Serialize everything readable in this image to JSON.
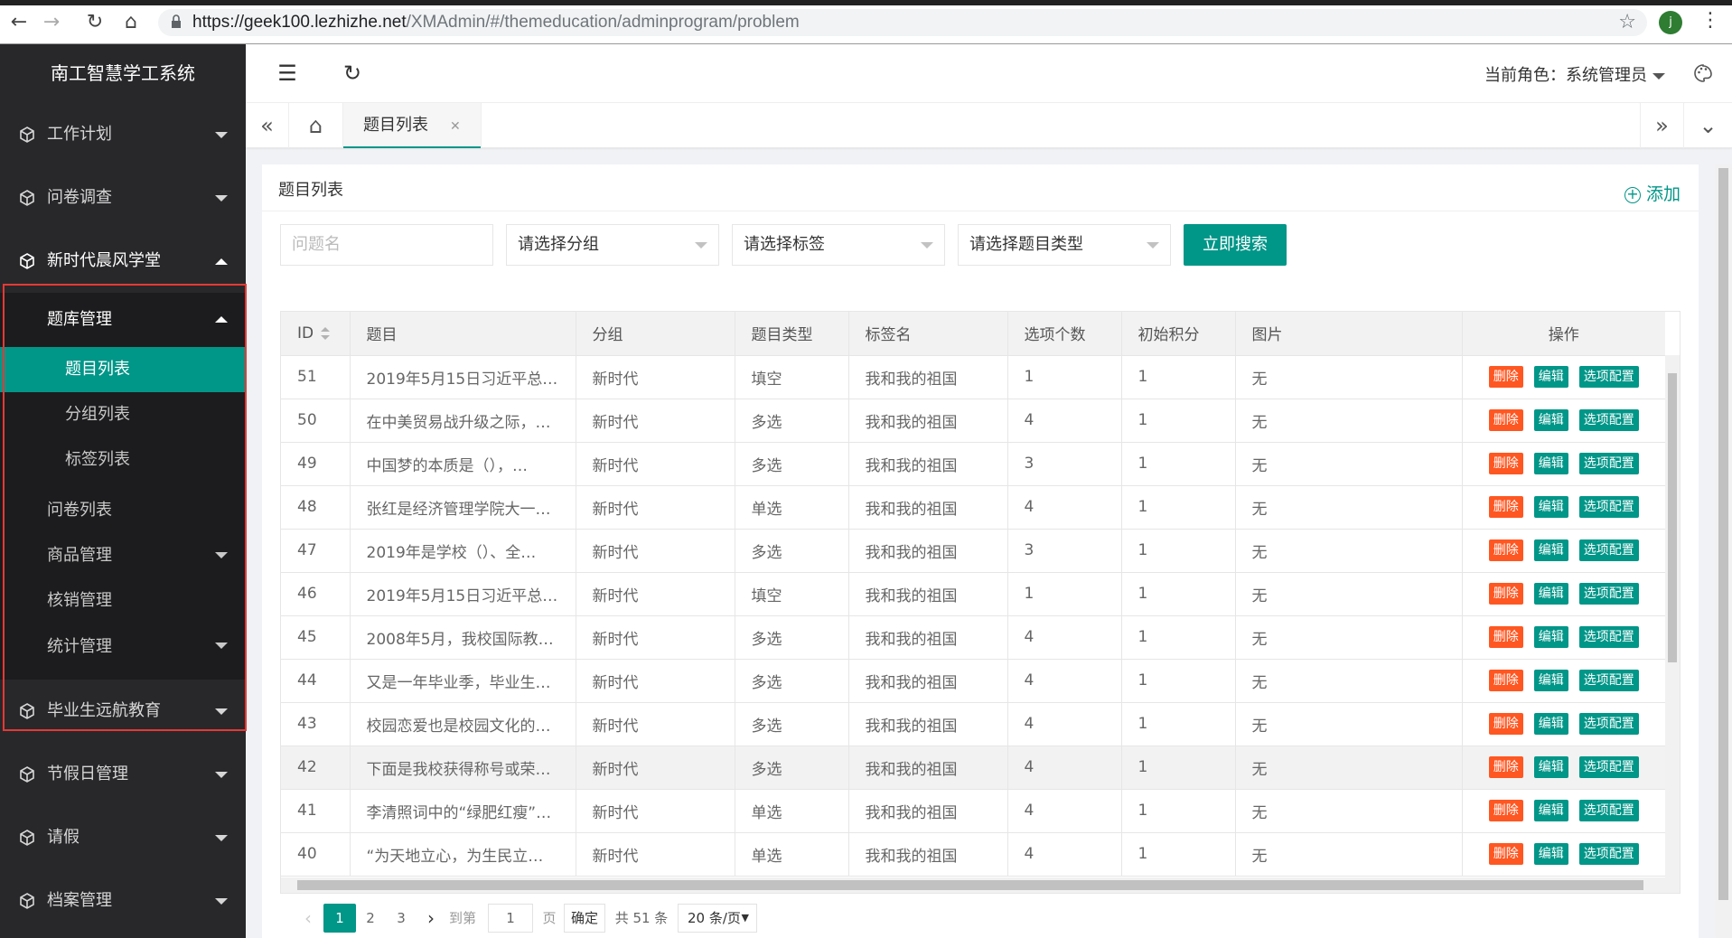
{
  "browser": {
    "url_host": "https://geek100.lezhizhe.net",
    "url_path": "/XMAdmin/#/themeducation/adminprogram/problem",
    "profile_initial": "j"
  },
  "sidebar": {
    "title": "南工智慧学工系统",
    "menu": [
      {
        "label": "工作计划"
      },
      {
        "label": "问卷调查"
      },
      {
        "label": "新时代晨风学堂"
      },
      {
        "label": "毕业生远航教育"
      },
      {
        "label": "节假日管理"
      },
      {
        "label": "请假"
      },
      {
        "label": "档案管理"
      }
    ],
    "sub": {
      "tiku": "题库管理",
      "tiku_children": [
        "题目列表",
        "分组列表",
        "标签列表"
      ],
      "wenjuan": "问卷列表",
      "shangpin": "商品管理",
      "hexiao": "核销管理",
      "tongji": "统计管理"
    }
  },
  "header": {
    "role_label": "当前角色：",
    "role_value": "系统管理员"
  },
  "tabs": {
    "active_tab": "题目列表"
  },
  "card": {
    "title": "题目列表",
    "add_label": "添加"
  },
  "filters": {
    "name_placeholder": "问题名",
    "group": "请选择分组",
    "tag": "请选择标签",
    "type": "请选择题目类型",
    "search_label": "立即搜索"
  },
  "table": {
    "headers": [
      "ID",
      "题目",
      "分组",
      "题目类型",
      "标签名",
      "选项个数",
      "初始积分",
      "图片",
      "操作"
    ],
    "actions": {
      "del": "删除",
      "edit": "编辑",
      "cfg": "选项配置"
    },
    "rows": [
      {
        "id": "51",
        "title": "2019年5月15日习近平总…",
        "group": "新时代",
        "type": "填空",
        "tag": "我和我的祖国",
        "options": "1",
        "score": "1",
        "img": "无"
      },
      {
        "id": "50",
        "title": "在中美贸易战升级之际，…",
        "group": "新时代",
        "type": "多选",
        "tag": "我和我的祖国",
        "options": "4",
        "score": "1",
        "img": "无"
      },
      {
        "id": "49",
        "title": "中国梦的本质是（），…",
        "group": "新时代",
        "type": "多选",
        "tag": "我和我的祖国",
        "options": "3",
        "score": "1",
        "img": "无"
      },
      {
        "id": "48",
        "title": "张红是经济管理学院大一…",
        "group": "新时代",
        "type": "单选",
        "tag": "我和我的祖国",
        "options": "4",
        "score": "1",
        "img": "无"
      },
      {
        "id": "47",
        "title": "2019年是学校（）、全…",
        "group": "新时代",
        "type": "多选",
        "tag": "我和我的祖国",
        "options": "3",
        "score": "1",
        "img": "无"
      },
      {
        "id": "46",
        "title": "2019年5月15日习近平总…",
        "group": "新时代",
        "type": "填空",
        "tag": "我和我的祖国",
        "options": "1",
        "score": "1",
        "img": "无"
      },
      {
        "id": "45",
        "title": "2008年5月，我校国际教…",
        "group": "新时代",
        "type": "多选",
        "tag": "我和我的祖国",
        "options": "4",
        "score": "1",
        "img": "无"
      },
      {
        "id": "44",
        "title": "又是一年毕业季，毕业生…",
        "group": "新时代",
        "type": "多选",
        "tag": "我和我的祖国",
        "options": "4",
        "score": "1",
        "img": "无"
      },
      {
        "id": "43",
        "title": "校园恋爱也是校园文化的…",
        "group": "新时代",
        "type": "多选",
        "tag": "我和我的祖国",
        "options": "4",
        "score": "1",
        "img": "无"
      },
      {
        "id": "42",
        "title": "下面是我校获得称号或荣…",
        "group": "新时代",
        "type": "多选",
        "tag": "我和我的祖国",
        "options": "4",
        "score": "1",
        "img": "无"
      },
      {
        "id": "41",
        "title": "李清照词中的“绿肥红瘦”…",
        "group": "新时代",
        "type": "单选",
        "tag": "我和我的祖国",
        "options": "4",
        "score": "1",
        "img": "无"
      },
      {
        "id": "40",
        "title": "“为天地立心，为生民立…",
        "group": "新时代",
        "type": "单选",
        "tag": "我和我的祖国",
        "options": "4",
        "score": "1",
        "img": "无"
      }
    ]
  },
  "pager": {
    "pages": [
      "1",
      "2",
      "3"
    ],
    "goto_label": "到第",
    "goto_value": "1",
    "page_unit": "页",
    "confirm": "确定",
    "total": "共 51 条",
    "page_size": "20 条/页"
  },
  "colors": {
    "accent": "#009688",
    "danger": "#ff5722",
    "sidebar": "#28282b",
    "highlight_border": "#e53935"
  }
}
